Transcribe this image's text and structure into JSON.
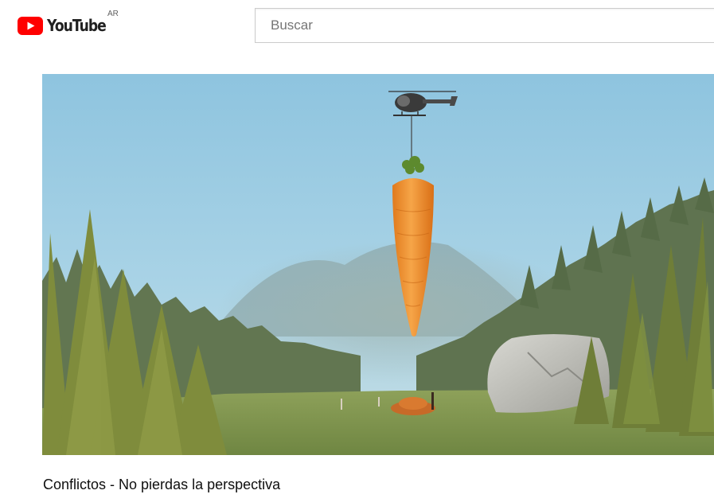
{
  "header": {
    "logo_text": "YouTube",
    "country_code": "AR",
    "logo_icon": "youtube-play-icon",
    "brand_color": "#FF0000"
  },
  "search": {
    "placeholder": "Buscar",
    "value": ""
  },
  "video": {
    "title": "Conflictos - No pierdas la perspectiva"
  }
}
